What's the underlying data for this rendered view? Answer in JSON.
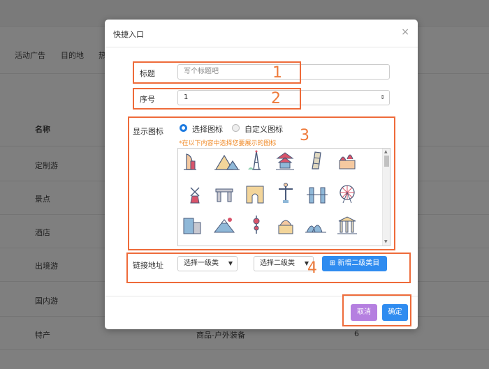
{
  "background": {
    "tabs": [
      "活动广告",
      "目的地",
      "热"
    ],
    "table_header": "名称",
    "rows": [
      "定制游",
      "景点",
      "酒店",
      "出境游",
      "国内游",
      "特产"
    ],
    "last_row_category": "商品-户外装备",
    "last_row_order": "6"
  },
  "modal": {
    "title": "快捷入口",
    "close_glyph": "×",
    "title_field": {
      "label": "标题",
      "placeholder": "写个标题吧"
    },
    "order_field": {
      "label": "序号",
      "value": "1"
    },
    "icon_field": {
      "label": "显示图标",
      "options": [
        "选择图标",
        "自定义图标"
      ],
      "selected": "选择图标",
      "hint": "*在以下内容中选择您要展示的图标"
    },
    "link_field": {
      "label": "链接地址",
      "level1_placeholder": "选择一级类",
      "level2_placeholder": "选择二级类",
      "add_button": "新增二级类目"
    },
    "cancel_label": "取消",
    "ok_label": "确定"
  },
  "icons": [
    "burj-al-arab-icon",
    "pyramids-icon",
    "eiffel-tower-icon",
    "temple-of-heaven-icon",
    "leaning-tower-icon",
    "st-basils-icon",
    "windmill-icon",
    "stonehenge-icon",
    "arc-de-triomphe-icon",
    "christ-redeemer-icon",
    "tower-bridge-icon",
    "ferris-wheel-icon",
    "building-icon",
    "mount-fuji-icon",
    "oriental-pearl-tower-icon",
    "taj-mahal-icon",
    "sydney-opera-icon",
    "parthenon-icon"
  ],
  "annotations": [
    "1",
    "2",
    "3",
    "4"
  ],
  "colors": {
    "accent": "#2f8cf0",
    "annotation": "#ee6b3a",
    "hint": "#f08b2a",
    "cancel": "#b57fe0"
  }
}
